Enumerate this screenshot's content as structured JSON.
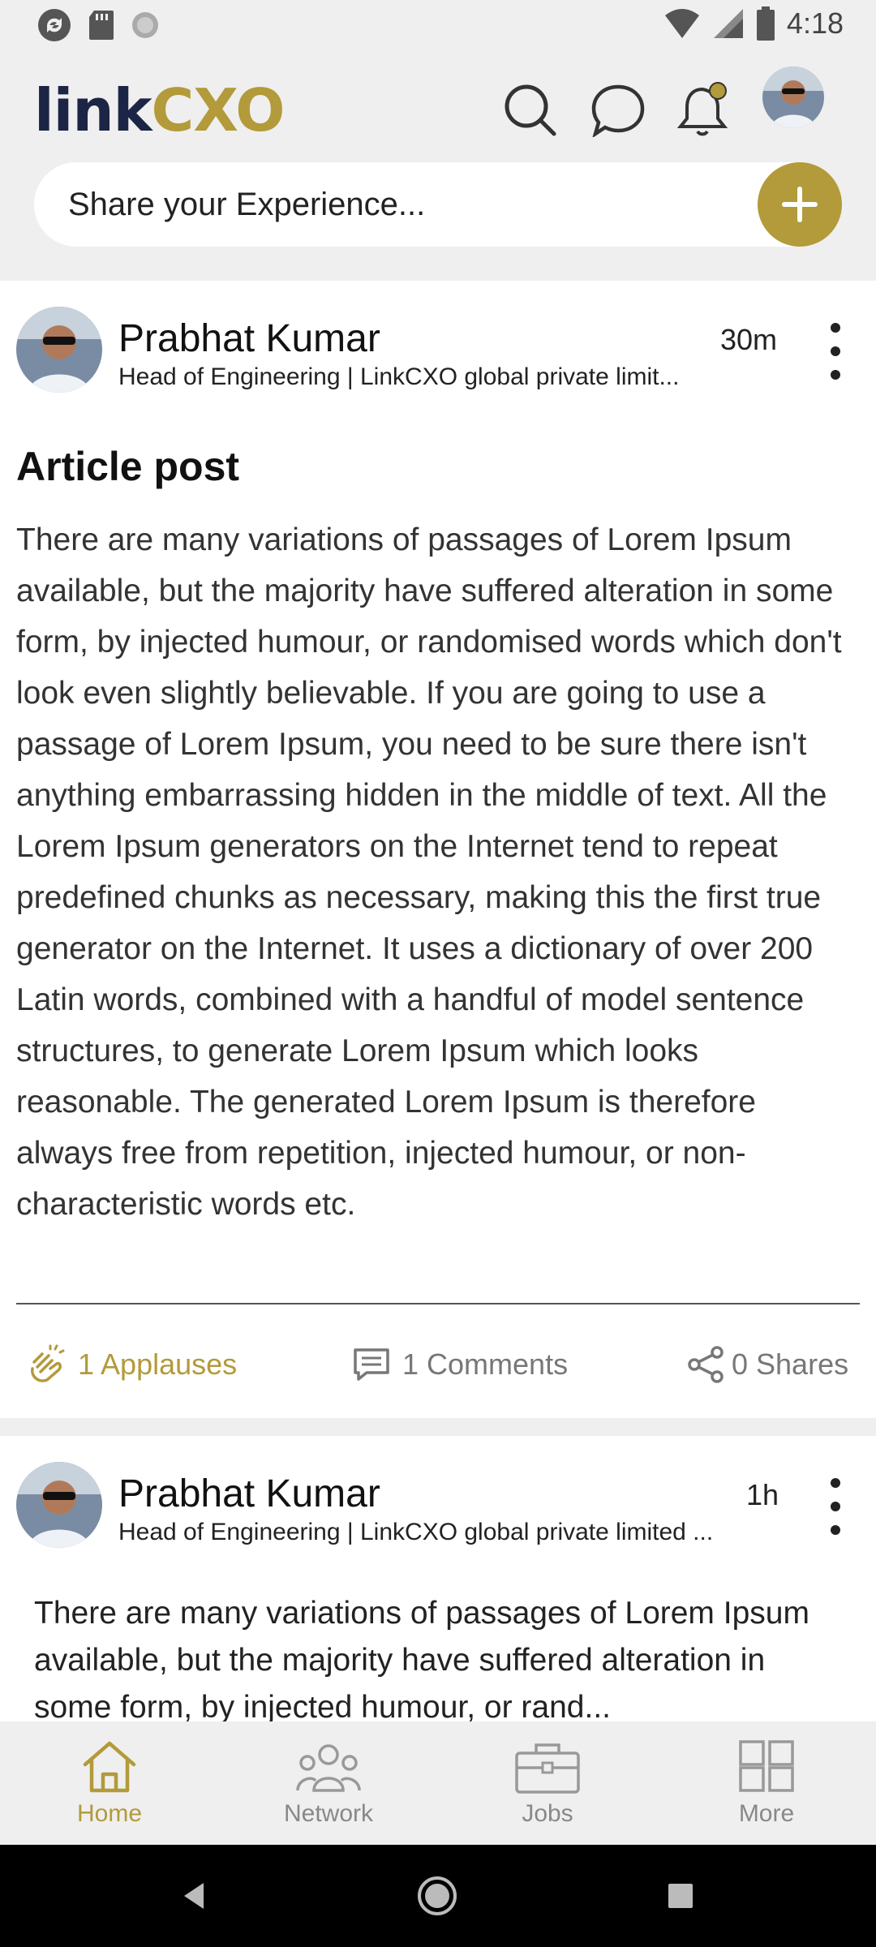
{
  "status_bar": {
    "time": "4:18"
  },
  "header": {
    "logo_left": "link",
    "logo_right": "CXO",
    "share_placeholder": "Share your Experience..."
  },
  "posts": [
    {
      "author": "Prabhat Kumar",
      "headline": "Head of Engineering | LinkCXO global private limit...",
      "time": "30m",
      "title": "Article post",
      "body": "There are many variations of passages of Lorem Ipsum available, but the majority have suffered alteration in some form, by injected humour, or randomised words which don't look even slightly believable. If you are going to use a passage of Lorem Ipsum, you need to be sure there isn't anything embarrassing hidden in the middle of text. All the Lorem Ipsum generators on the Internet tend to repeat predefined chunks as necessary, making this the first true generator on the Internet. It uses a dictionary of over 200 Latin words, combined with a handful of model sentence structures, to generate Lorem Ipsum which looks reasonable. The generated Lorem Ipsum is therefore always free from repetition, injected humour, or non-characteristic words etc.",
      "applauses": "1 Applauses",
      "comments": "1 Comments",
      "shares": "0 Shares"
    },
    {
      "author": "Prabhat Kumar",
      "headline": "Head of Engineering | LinkCXO global private limited ...",
      "time": "1h",
      "body": "There are many variations of passages of Lorem Ipsum available, but the majority have suffered alteration in some form, by injected humour, or rand..."
    }
  ],
  "bottom_nav": {
    "home": "Home",
    "network": "Network",
    "jobs": "Jobs",
    "more": "More"
  },
  "colors": {
    "accent": "#b39a3a",
    "brand_dark": "#1c2545",
    "background": "#efefef"
  }
}
